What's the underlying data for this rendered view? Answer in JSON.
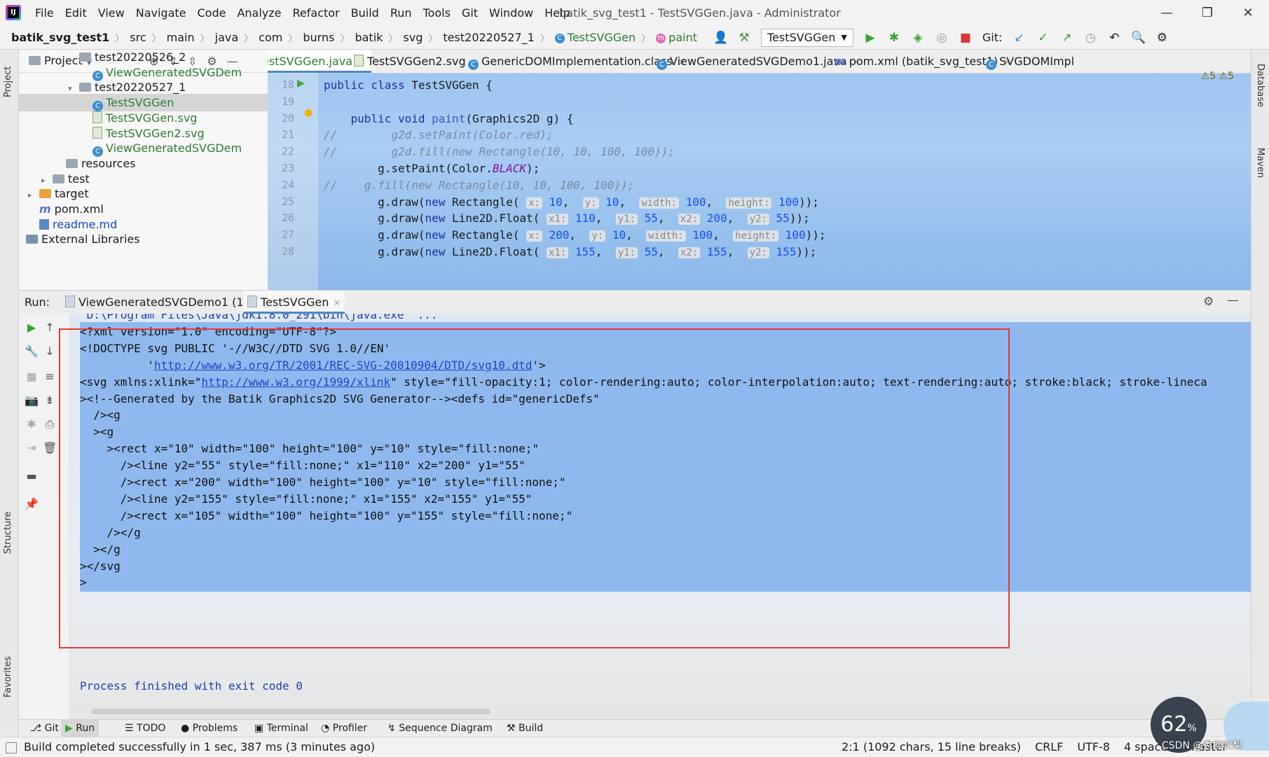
{
  "menubar": {
    "items": [
      "File",
      "Edit",
      "View",
      "Navigate",
      "Code",
      "Analyze",
      "Refactor",
      "Build",
      "Run",
      "Tools",
      "Git",
      "Window",
      "Help"
    ],
    "title": "batik_svg_test1 - TestSVGGen.java - Administrator"
  },
  "breadcrumbs": [
    "batik_svg_test1",
    "src",
    "main",
    "java",
    "com",
    "burns",
    "batik",
    "svg",
    "test20220527_1",
    "TestSVGGen",
    "paint"
  ],
  "toolbar": {
    "run_config": "TestSVGGen",
    "git_label": "Git:"
  },
  "project": {
    "header": "Project",
    "tree": [
      {
        "label": "test20220526_2",
        "indent": 3,
        "kind": "folder",
        "partial": true
      },
      {
        "label": "ViewGeneratedSVGDem",
        "indent": 4,
        "kind": "class"
      },
      {
        "label": "test20220527_1",
        "indent": 3,
        "kind": "folder",
        "expanded": true
      },
      {
        "label": "TestSVGGen",
        "indent": 4,
        "kind": "class",
        "selected": true
      },
      {
        "label": "TestSVGGen.svg",
        "indent": 4,
        "kind": "svg"
      },
      {
        "label": "TestSVGGen2.svg",
        "indent": 4,
        "kind": "svg"
      },
      {
        "label": "ViewGeneratedSVGDem",
        "indent": 4,
        "kind": "class"
      },
      {
        "label": "resources",
        "indent": 2,
        "kind": "folder"
      },
      {
        "label": "test",
        "indent": 1,
        "kind": "folder",
        "collapsed": true
      },
      {
        "label": "target",
        "indent": 0,
        "kind": "orange",
        "collapsed": true
      },
      {
        "label": "pom.xml",
        "indent": 0,
        "kind": "maven"
      },
      {
        "label": "readme.md",
        "indent": 0,
        "kind": "md"
      },
      {
        "label": "External Libraries",
        "indent": -1,
        "kind": "lib",
        "expanded": true
      }
    ]
  },
  "editor": {
    "tabs": [
      "TestSVGGen.java",
      "TestSVGGen2.svg",
      "GenericDOMImplementation.class",
      "ViewGeneratedSVGDemo1.java",
      "pom.xml (batik_svg_test1)",
      "SVGDOMImpl"
    ],
    "warnings": "⚠5  ⚠5",
    "lines": [
      {
        "n": "18",
        "html": "<span class=\"kw\">public class</span> TestSVGGen {"
      },
      {
        "n": "19",
        "html": ""
      },
      {
        "n": "20",
        "html": "    <span class=\"kw\">public void</span> <span class=\"fn\">paint</span>(Graphics2D g) {"
      },
      {
        "n": "21",
        "html": "<span class=\"cm\">//        g2d.setPaint(Color.red);</span>"
      },
      {
        "n": "22",
        "html": "<span class=\"cm\">//        g2d.fill(new Rectangle(10, 10, 100, 100));</span>"
      },
      {
        "n": "23",
        "html": "        g.setPaint(Color.<span class=\"static\">BLACK</span>);"
      },
      {
        "n": "24",
        "html": "<span class=\"cm\">//    g.fill(new Rectangle(10, 10, 100, 100));</span>"
      },
      {
        "n": "25",
        "html": "        g.draw(<span class=\"kw\">new</span> Rectangle( <span class=\"hint\">x:</span> <span class=\"num\">10</span>,  <span class=\"hint\">y:</span> <span class=\"num\">10</span>,  <span class=\"hint\">width:</span> <span class=\"num\">100</span>,  <span class=\"hint\">height:</span> <span class=\"num\">100</span>));"
      },
      {
        "n": "26",
        "html": "        g.draw(<span class=\"kw\">new</span> Line2D.Float( <span class=\"hint\">x1:</span> <span class=\"num\">110</span>,  <span class=\"hint\">y1:</span> <span class=\"num\">55</span>,  <span class=\"hint\">x2:</span> <span class=\"num\">200</span>,  <span class=\"hint\">y2:</span> <span class=\"num\">55</span>));"
      },
      {
        "n": "27",
        "html": "        g.draw(<span class=\"kw\">new</span> Rectangle( <span class=\"hint\">x:</span> <span class=\"num\">200</span>,  <span class=\"hint\">y:</span> <span class=\"num\">10</span>,  <span class=\"hint\">width:</span> <span class=\"num\">100</span>,  <span class=\"hint\">height:</span> <span class=\"num\">100</span>));"
      },
      {
        "n": "28",
        "html": "        g.draw(<span class=\"kw\">new</span> Line2D.Float( <span class=\"hint\">x1:</span> <span class=\"num\">155</span>,  <span class=\"hint\">y1:</span> <span class=\"num\">55</span>,  <span class=\"hint\">x2:</span> <span class=\"num\">155</span>,  <span class=\"hint\">y2:</span> <span class=\"num\">155</span>));"
      }
    ]
  },
  "run": {
    "label": "Run:",
    "tabs": [
      "ViewGeneratedSVGDemo1 (1)",
      "TestSVGGen"
    ],
    "console": [
      {
        "text": "\"D:\\Program Files\\Java\\jdk1.8.0_291\\bin\\java.exe\" ...",
        "hl": false
      },
      {
        "text": "<?xml version=\"1.0\" encoding=\"UTF-8\"?>",
        "hl": true
      },
      {
        "text": "<!DOCTYPE svg PUBLIC '-//W3C//DTD SVG 1.0//EN'",
        "hl": true
      },
      {
        "pre": "          '",
        "link": "http://www.w3.org/TR/2001/REC-SVG-20010904/DTD/svg10.dtd",
        "post": "'>",
        "hl": true
      },
      {
        "pre": "<svg xmlns:xlink=\"",
        "link": "http://www.w3.org/1999/xlink",
        "post": "\" style=\"fill-opacity:1; color-rendering:auto; color-interpolation:auto; text-rendering:auto; stroke:black; stroke-lineca",
        "hl": true
      },
      {
        "text": "><!--Generated by the Batik Graphics2D SVG Generator--><defs id=\"genericDefs\"",
        "hl": true
      },
      {
        "text": "  /><g",
        "hl": true
      },
      {
        "text": "  ><g",
        "hl": true
      },
      {
        "text": "    ><rect x=\"10\" width=\"100\" height=\"100\" y=\"10\" style=\"fill:none;\"",
        "hl": true
      },
      {
        "text": "      /><line y2=\"55\" style=\"fill:none;\" x1=\"110\" x2=\"200\" y1=\"55\"",
        "hl": true
      },
      {
        "text": "      /><rect x=\"200\" width=\"100\" height=\"100\" y=\"10\" style=\"fill:none;\"",
        "hl": true
      },
      {
        "text": "      /><line y2=\"155\" style=\"fill:none;\" x1=\"155\" x2=\"155\" y1=\"55\"",
        "hl": true
      },
      {
        "text": "      /><rect x=\"105\" width=\"100\" height=\"100\" y=\"155\" style=\"fill:none;\"",
        "hl": true
      },
      {
        "text": "    /></g",
        "hl": true
      },
      {
        "text": "  ></g",
        "hl": true
      },
      {
        "text": "></svg",
        "hl": true
      },
      {
        "text": ">",
        "hl": true
      }
    ],
    "process": "Process finished with exit code 0"
  },
  "toolwindows": [
    "Git",
    "Run",
    "TODO",
    "Problems",
    "Terminal",
    "Profiler",
    "Sequence Diagram",
    "Build"
  ],
  "status": {
    "message": "Build completed successfully in 1 sec, 387 ms (3 minutes ago)",
    "position": "2:1 (1092 chars, 15 line breaks)",
    "line_sep": "CRLF",
    "encoding": "UTF-8",
    "indent": "4 spaces",
    "branch": "master"
  },
  "side_labels": {
    "left_top": "Project",
    "left_struct": "Structure",
    "left_fav": "Favorites",
    "right_db": "Database",
    "right_maven": "Maven"
  },
  "overlay": {
    "percent": "62",
    "percent_unit": "%",
    "watermark": "CSDN @秀柳吹梨"
  }
}
